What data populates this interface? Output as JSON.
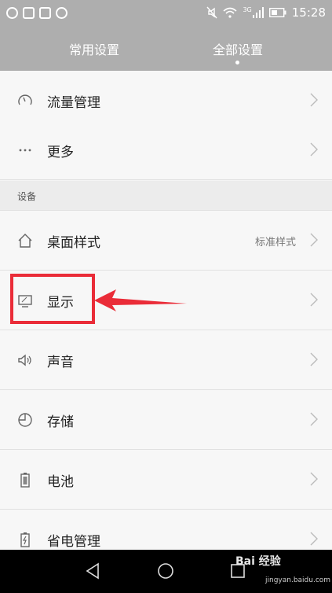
{
  "status_bar": {
    "time": "15:28",
    "network_label": "3G"
  },
  "tabs": [
    {
      "label": "常用设置",
      "active": false
    },
    {
      "label": "全部设置",
      "active": true
    }
  ],
  "rows": [
    {
      "label": "流量管理",
      "icon": "gauge-icon"
    },
    {
      "label": "更多",
      "icon": "ellipsis-icon"
    },
    {
      "label": "桌面样式",
      "value": "标准样式",
      "icon": "home-icon"
    },
    {
      "label": "显示",
      "icon": "display-icon"
    },
    {
      "label": "声音",
      "icon": "speaker-icon"
    },
    {
      "label": "存储",
      "icon": "pie-chart-icon"
    },
    {
      "label": "电池",
      "icon": "battery-icon"
    },
    {
      "label": "省电管理",
      "icon": "battery-charging-icon"
    }
  ],
  "section": {
    "title": "设备"
  },
  "watermark": {
    "main": "Bai 经验",
    "sub": "jingyan.baidu.com"
  },
  "colors": {
    "header": "#aeaeae",
    "highlight": "#ea2c38",
    "nav_bar": "#000000"
  }
}
